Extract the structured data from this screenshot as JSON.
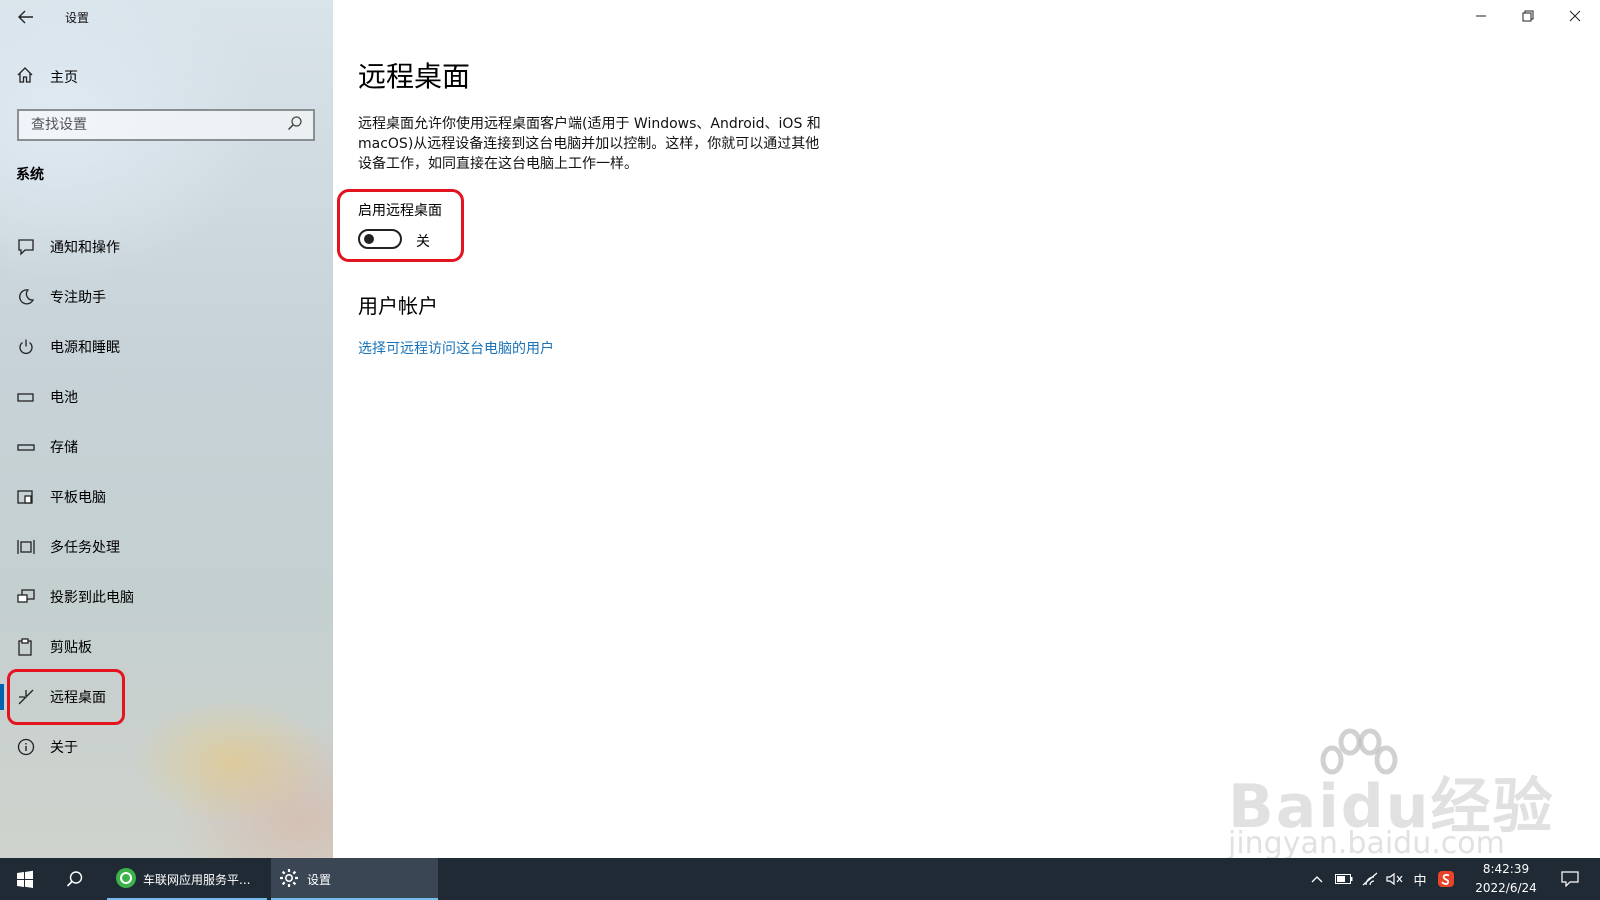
{
  "window": {
    "title": "设置",
    "controls": {
      "minimize": "—",
      "restore": "❐",
      "close": "✕"
    }
  },
  "sidebar": {
    "home_label": "主页",
    "search_placeholder": "查找设置",
    "section_title": "系统",
    "items": [
      {
        "label": "通知和操作",
        "icon": "notification-icon"
      },
      {
        "label": "专注助手",
        "icon": "moon-icon"
      },
      {
        "label": "电源和睡眠",
        "icon": "power-icon"
      },
      {
        "label": "电池",
        "icon": "battery-icon"
      },
      {
        "label": "存储",
        "icon": "storage-icon"
      },
      {
        "label": "平板电脑",
        "icon": "tablet-icon"
      },
      {
        "label": "多任务处理",
        "icon": "multitask-icon"
      },
      {
        "label": "投影到此电脑",
        "icon": "project-icon"
      },
      {
        "label": "剪贴板",
        "icon": "clipboard-icon"
      },
      {
        "label": "远程桌面",
        "icon": "remote-desktop-icon",
        "selected": true
      },
      {
        "label": "关于",
        "icon": "info-icon"
      }
    ]
  },
  "main": {
    "title": "远程桌面",
    "description": "远程桌面允许你使用远程桌面客户端(适用于 Windows、Android、iOS 和 macOS)从远程设备连接到这台电脑并加以控制。这样，你就可以通过其他设备工作，如同直接在这台电脑上工作一样。",
    "toggle": {
      "label": "启用远程桌面",
      "state": "关",
      "on": false
    },
    "users_section_title": "用户帐户",
    "users_link": "选择可远程访问这台电脑的用户"
  },
  "watermark": {
    "text": "Baidu经验",
    "url": "jingyan.baidu.com"
  },
  "taskbar": {
    "apps": [
      {
        "label": "车联网应用服务平...",
        "icon": "browser-icon"
      },
      {
        "label": "设置",
        "icon": "gear-icon",
        "active": true
      }
    ],
    "tray": {
      "ime": "中"
    },
    "clock": {
      "time": "8:42:39",
      "date": "2022/6/24"
    }
  },
  "colors": {
    "accent": "#0063b1",
    "link": "#1a73b8",
    "highlight": "#e3131f",
    "taskbar": "#1f2a35"
  }
}
